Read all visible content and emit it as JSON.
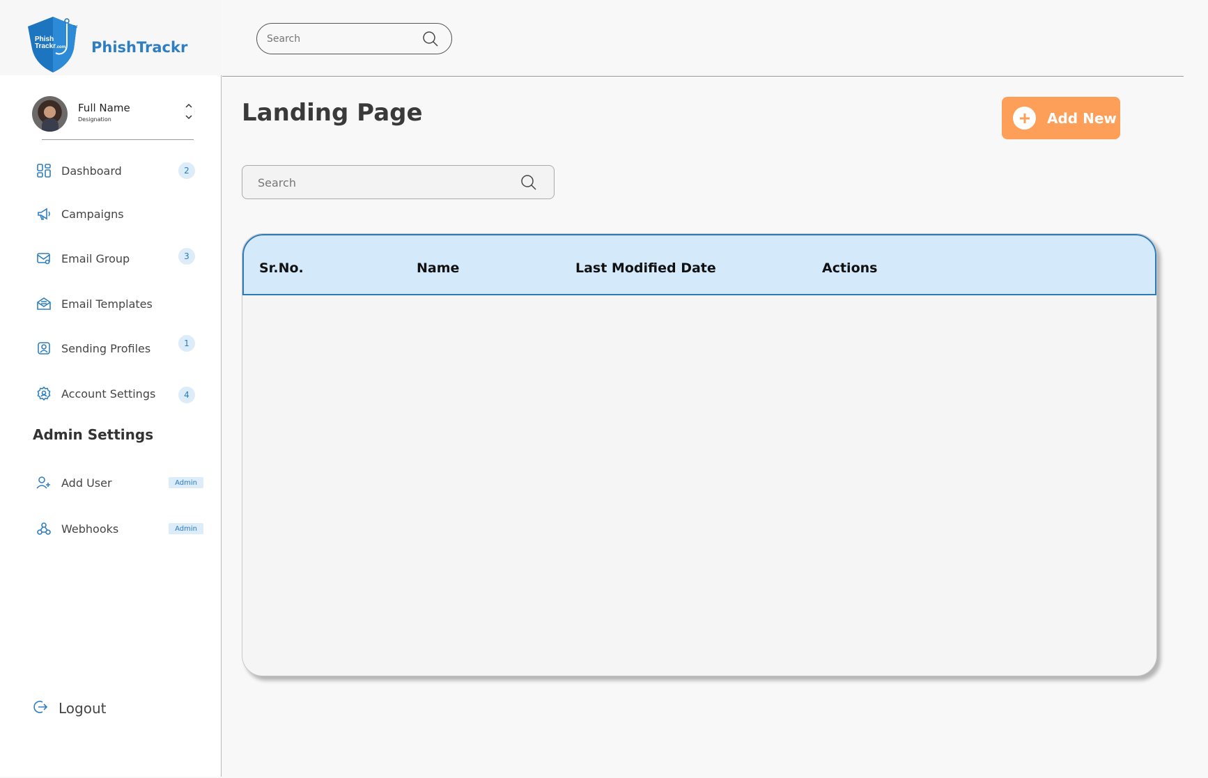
{
  "brand": {
    "name": "PhishTrackr",
    "logo_line1": "Phish",
    "logo_line2": "Trackr",
    "logo_domain": ".com",
    "logo_tm": "TM"
  },
  "profile": {
    "name": "Full Name",
    "designation": "Designation"
  },
  "nav": [
    {
      "label": "Dashboard",
      "icon": "dashboard-icon",
      "badge": "2"
    },
    {
      "label": "Campaigns",
      "icon": "megaphone-icon",
      "badge": ""
    },
    {
      "label": "Email Group",
      "icon": "email-group-icon",
      "badge": "3"
    },
    {
      "label": "Email Templates",
      "icon": "email-template-icon",
      "badge": ""
    },
    {
      "label": "Sending Profiles",
      "icon": "profile-icon",
      "badge": "1"
    },
    {
      "label": "Account Settings",
      "icon": "gear-icon",
      "badge": "4"
    }
  ],
  "admin": {
    "section_title": "Admin Settings",
    "items": [
      {
        "label": "Add User",
        "icon": "add-user-icon",
        "tag": "Admin"
      },
      {
        "label": "Webhooks",
        "icon": "webhook-icon",
        "tag": "Admin"
      }
    ]
  },
  "logout": {
    "label": "Logout"
  },
  "topbar": {
    "search_placeholder": "Search"
  },
  "main": {
    "title": "Landing Page",
    "add_button": "Add New",
    "search_placeholder": "Search",
    "table": {
      "columns": [
        "Sr.No.",
        "Name",
        "Last Modified Date",
        "Actions"
      ],
      "rows": []
    }
  },
  "colors": {
    "accent": "#2f7ec1",
    "button": "#fd9f58",
    "table_header": "#d4eafa",
    "badge_bg": "#dcecf9"
  }
}
